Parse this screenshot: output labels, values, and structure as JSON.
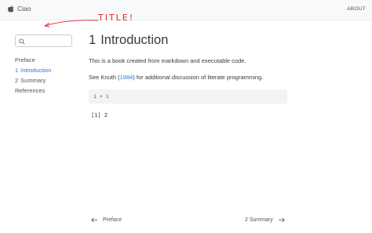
{
  "navbar": {
    "brand": "Ciao",
    "about": "ABOUT"
  },
  "annotation": {
    "text": "TITLE!",
    "color": "#e0242b"
  },
  "sidebar": {
    "search": {
      "icon": "search-icon",
      "value": "",
      "placeholder": ""
    },
    "items": [
      {
        "number": "",
        "label": "Preface",
        "active": false
      },
      {
        "number": "1",
        "label": "Introduction",
        "active": true
      },
      {
        "number": "2",
        "label": "Summary",
        "active": false
      },
      {
        "number": "",
        "label": "References",
        "active": false
      }
    ]
  },
  "main": {
    "chapter_number": "1",
    "chapter_title": "Introduction",
    "para1": "This is a book created from markdown and executable code.",
    "para2": {
      "before": "See Knuth (",
      "cite": "1984",
      "after": ") for additional discussion of literate programming."
    },
    "code": {
      "left": "1",
      "op": "+",
      "right": "1"
    },
    "output": "[1] 2"
  },
  "page_nav": {
    "prev_label": "Preface",
    "next_label": "2 Summary"
  },
  "colors": {
    "accent": "#2a76dd",
    "code_bg": "#f1f3f5"
  }
}
